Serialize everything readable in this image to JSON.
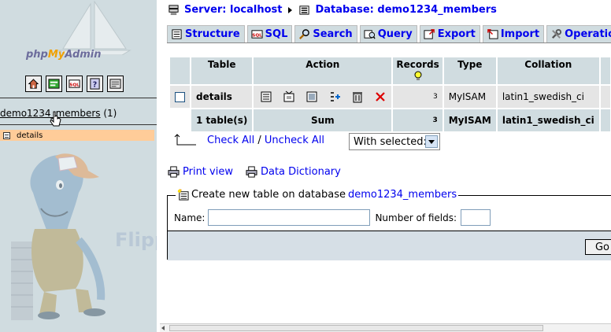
{
  "left": {
    "logo": {
      "php": "php",
      "my": "My",
      "admin": "Admin"
    },
    "icons": [
      "home-icon",
      "query-window-icon",
      "sql-icon",
      "documentation-icon",
      "query-log-icon"
    ],
    "db": {
      "name": "demo1234_members",
      "count": "(1)"
    },
    "tables": [
      "details"
    ],
    "watermark": "FlipperHost"
  },
  "breadcrumb": {
    "server": "Server: localhost",
    "database": "Database: demo1234_members"
  },
  "tabs": [
    "Structure",
    "SQL",
    "Search",
    "Query",
    "Export",
    "Import",
    "Operations"
  ],
  "table": {
    "headers": {
      "table": "Table",
      "action": "Action",
      "records": "Records",
      "type": "Type",
      "collation": "Collation"
    },
    "rows": [
      {
        "name": "details",
        "records": "3",
        "type": "MyISAM",
        "collation": "latin1_swedish_ci"
      }
    ],
    "sum": {
      "label": "1 table(s)",
      "action": "Sum",
      "records": "3",
      "type": "MyISAM",
      "collation": "latin1_swedish_ci"
    }
  },
  "check": {
    "check_all": "Check All",
    "separator": "/",
    "uncheck_all": "Uncheck All",
    "with_selected": "With selected:"
  },
  "links": {
    "print": "Print view",
    "dictionary": "Data Dictionary"
  },
  "create": {
    "legend": "Create new table on database",
    "db": "demo1234_members",
    "name_label": "Name:",
    "fields_label": "Number of fields:",
    "go": "Go"
  },
  "colors": {
    "frame_bg": "#d0dce0",
    "selected_item": "#ffcc99",
    "link": "#0000ee",
    "logo_orange": "#f0a000"
  }
}
